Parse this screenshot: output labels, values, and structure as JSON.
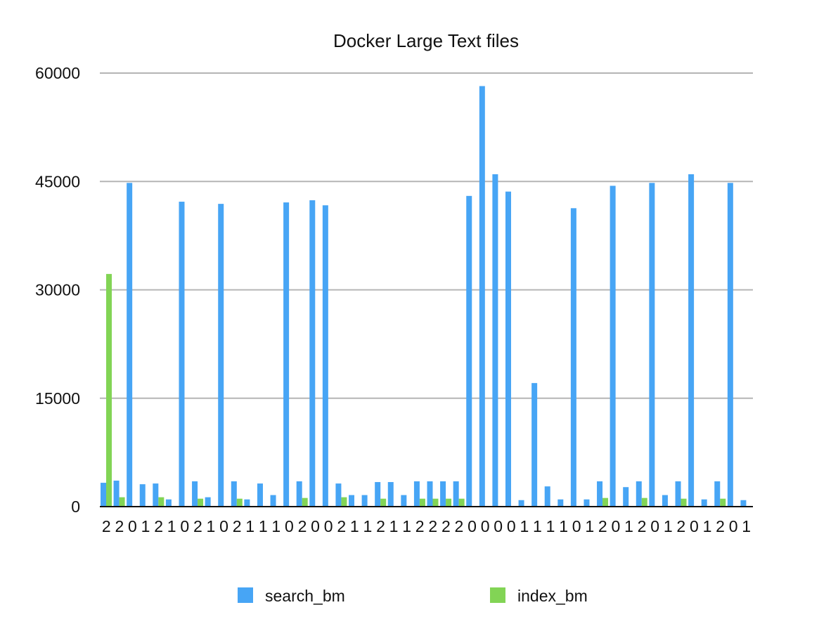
{
  "chart_data": {
    "type": "bar",
    "title": "Docker Large Text files",
    "xlabel": "",
    "ylabel": "",
    "ylim": [
      0,
      60000
    ],
    "yticks": [
      "0",
      "15000",
      "30000",
      "45000",
      "60000"
    ],
    "grid": true,
    "legend_position": "bottom",
    "categories": [
      "2",
      "2",
      "0",
      "1",
      "2",
      "1",
      "0",
      "2",
      "1",
      "0",
      "2",
      "1",
      "1",
      "1",
      "0",
      "2",
      "0",
      "0",
      "2",
      "1",
      "1",
      "2",
      "1",
      "1",
      "2",
      "2",
      "2",
      "2",
      "0",
      "0",
      "0",
      "0",
      "1",
      "1",
      "1",
      "1",
      "0",
      "1",
      "2",
      "0",
      "1",
      "2",
      "0",
      "1",
      "2",
      "0",
      "1",
      "2",
      "0",
      "1"
    ],
    "series": [
      {
        "name": "search_bm",
        "color": "#47a5f5",
        "values": [
          3300,
          3600,
          44800,
          3100,
          3200,
          1000,
          42200,
          3500,
          1300,
          41900,
          3500,
          1000,
          3200,
          1600,
          42100,
          3500,
          42400,
          41700,
          3200,
          1600,
          1600,
          3400,
          3400,
          1600,
          3500,
          3500,
          3500,
          3500,
          43000,
          58200,
          46000,
          43600,
          900,
          17100,
          2800,
          1000,
          41300,
          1000,
          3500,
          44400,
          2700,
          3500,
          44800,
          1600,
          3500,
          46000,
          1000,
          3500,
          44800,
          900
        ]
      },
      {
        "name": "index_bm",
        "color": "#82d455",
        "values": [
          32200,
          1300,
          0,
          0,
          1300,
          0,
          0,
          1100,
          0,
          0,
          1100,
          0,
          0,
          0,
          0,
          1200,
          0,
          0,
          1300,
          0,
          0,
          1100,
          0,
          0,
          1100,
          1100,
          1100,
          1100,
          0,
          0,
          0,
          0,
          0,
          0,
          0,
          0,
          0,
          0,
          1200,
          0,
          0,
          1200,
          0,
          0,
          1100,
          0,
          0,
          1100,
          0,
          0
        ]
      }
    ]
  }
}
